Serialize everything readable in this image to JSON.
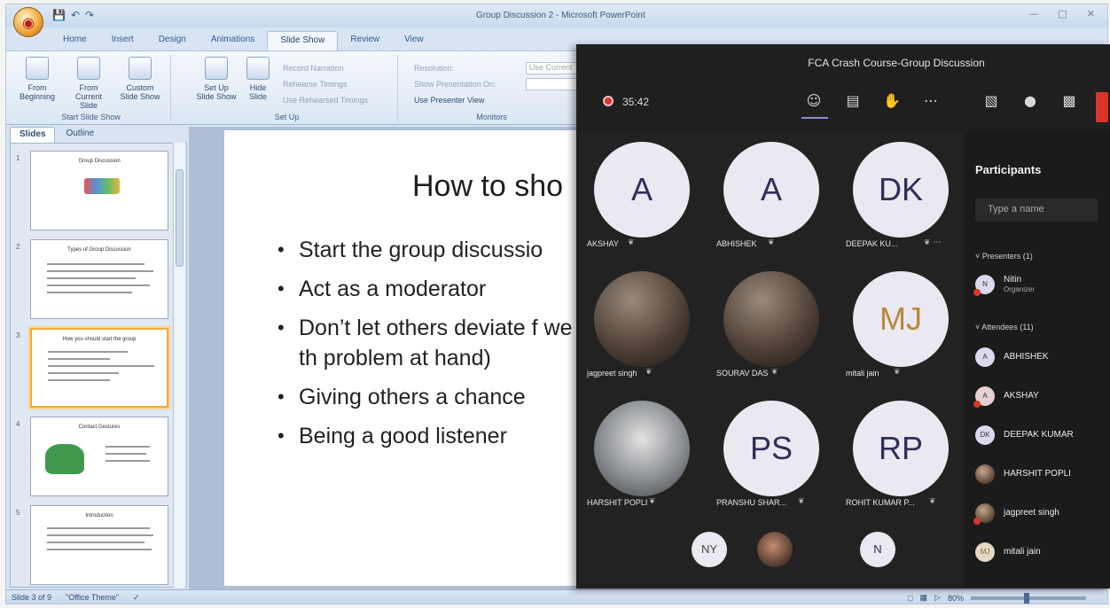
{
  "powerpoint": {
    "window_title": "Group Discussion 2 - Microsoft PowerPoint",
    "tabs": [
      "Home",
      "Insert",
      "Design",
      "Animations",
      "Slide Show",
      "Review",
      "View"
    ],
    "active_tab": "Slide Show",
    "ribbon": {
      "from_beginning": "From Beginning",
      "from_current": "From Current Slide",
      "custom_show": "Custom Slide Show",
      "start_group": "Start Slide Show",
      "set_up_show": "Set Up Slide Show",
      "hide_slide": "Hide Slide",
      "record_narration": "Record Narration",
      "rehearse_timings": "Rehearse Timings",
      "use_rehearsed": "Use Rehearsed Timings",
      "setup_group": "Set Up",
      "resolution": "Resolution:",
      "show_on": "Show Presentation On:",
      "use_presenter": "Use Presenter View",
      "use_current": "Use Current",
      "monitors_group": "Monitors"
    },
    "pane_tabs": [
      "Slides",
      "Outline"
    ],
    "thumbnails": [
      {
        "num": "1",
        "title": "Group Discussion"
      },
      {
        "num": "2",
        "title": "Types of Group Discussion"
      },
      {
        "num": "3",
        "title": "How you should start the group"
      },
      {
        "num": "4",
        "title": "Contact Gestures"
      },
      {
        "num": "5",
        "title": "Introduction"
      }
    ],
    "slide": {
      "title": "How to sho",
      "bullets": [
        "Start the group discussio",
        "Act as a moderator",
        "Don’t let others deviate f we are deviating from th problem at hand)",
        "Giving others a chance",
        "Being a good listener"
      ]
    },
    "status": {
      "slide_of": "Slide 3 of 9",
      "theme": "\"Office Theme\"",
      "zoom": "80%"
    }
  },
  "teams": {
    "meeting_title": "FCA Crash Course-Group Discussion",
    "timer": "35:42",
    "tiles": [
      {
        "initials": "A",
        "name": "AKSHAY",
        "photo": false
      },
      {
        "initials": "A",
        "name": "ABHISHEK",
        "photo": false
      },
      {
        "initials": "DK",
        "name": "DEEPAK KU...",
        "photo": false
      },
      {
        "initials": "",
        "name": "jagpreet singh",
        "photo": true
      },
      {
        "initials": "",
        "name": "SOURAV DAS",
        "photo": true
      },
      {
        "initials": "MJ",
        "name": "mitali jain",
        "photo": false
      },
      {
        "initials": "",
        "name": "HARSHIT POPLI",
        "photo": true
      },
      {
        "initials": "PS",
        "name": "PRANSHU SHAR...",
        "photo": false
      },
      {
        "initials": "RP",
        "name": "ROHIT KUMAR P...",
        "photo": false
      }
    ],
    "overflow_avatars": [
      "NY",
      "",
      "N"
    ],
    "participants": {
      "title": "Participants",
      "search_placeholder": "Type a name",
      "presenters_label": "Presenters (1)",
      "presenter": {
        "initials": "N",
        "name": "Nitin",
        "role": "Organizer"
      },
      "attendees_label": "Attendees (11)",
      "attendees": [
        {
          "initials": "A",
          "name": "ABHISHEK",
          "photo": false
        },
        {
          "initials": "A",
          "name": "AKSHAY",
          "photo": false
        },
        {
          "initials": "DK",
          "name": "DEEPAK KUMAR",
          "photo": false
        },
        {
          "initials": "",
          "name": "HARSHIT POPLI",
          "photo": true
        },
        {
          "initials": "",
          "name": "jagpreet singh",
          "photo": true
        },
        {
          "initials": "MJ",
          "name": "mitali jain",
          "photo": false
        }
      ]
    }
  }
}
